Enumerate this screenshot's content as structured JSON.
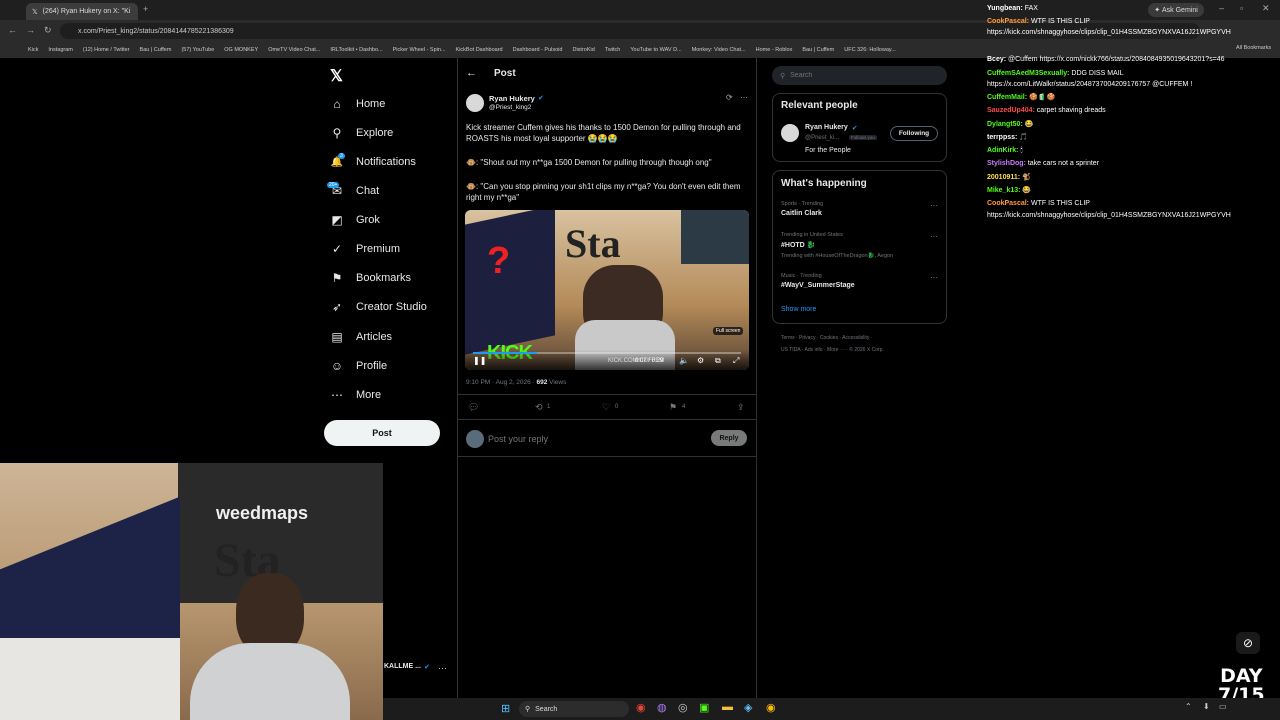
{
  "browser": {
    "tabs": [
      {
        "title": "(264) Ryan Hukery on X: \"Ki"
      }
    ],
    "url": "x.com/Priest_king2/status/2084144785221386309",
    "ask_gemini": "Ask Gemini",
    "bookmarks": [
      "Kick",
      "Instagram",
      "(12) Home / Twitter",
      "Bau | Cuffem",
      "(57) YouTube",
      "OG MONKEY",
      "OmeTV Video Chat...",
      "IRLToolkit • Dashbo...",
      "Picker Wheel - Spin...",
      "KickBot Dashboard",
      "Dashboard - Pulsoid",
      "DistroKid",
      "Twitch",
      "YouTube to WAV D...",
      "Monkey: Video Chat...",
      "Home - Roblox",
      "Bau | Cuffem",
      "UFC 326: Holloway..."
    ],
    "all_bookmarks": "All Bookmarks"
  },
  "nav": {
    "items": [
      {
        "label": "Home",
        "icon": "home-icon",
        "glyph": "⌂"
      },
      {
        "label": "Explore",
        "icon": "search-icon",
        "glyph": "⚲"
      },
      {
        "label": "Notifications",
        "icon": "bell-icon",
        "glyph": "🔔"
      },
      {
        "label": "Chat",
        "icon": "chat-icon",
        "glyph": "✉"
      },
      {
        "label": "Grok",
        "icon": "grok-icon",
        "glyph": "◩"
      },
      {
        "label": "Premium",
        "icon": "premium-icon",
        "glyph": "✓"
      },
      {
        "label": "Bookmarks",
        "icon": "bookmark-icon",
        "glyph": "⚑"
      },
      {
        "label": "Creator Studio",
        "icon": "rocket-icon",
        "glyph": "➶"
      },
      {
        "label": "Articles",
        "icon": "article-icon",
        "glyph": "▤"
      },
      {
        "label": "Profile",
        "icon": "profile-icon",
        "glyph": "☺"
      },
      {
        "label": "More",
        "icon": "more-icon",
        "glyph": "⋯"
      }
    ],
    "notif_badge": "3",
    "chat_badge": "20+",
    "post_label": "Post",
    "account_name": "KALLME ..."
  },
  "post": {
    "header": "Post",
    "author_name": "Ryan Hukery",
    "author_handle": "@Priest_king2",
    "text1": "Kick streamer Cuffem gives his thanks to 1500 Demon for pulling through and ROASTS his most loyal supporter 😭😭😭",
    "quote1": "🐵: \"Shout out my n**ga 1500 Demon for pulling through though ong\"",
    "quote2": "🐵: \"Can you stop pinning your sh1t clips my n**ga? You don't even edit them right my n**ga\"",
    "video_time": "0:07 / 0:29",
    "video_source": "KICK.COM/CUFFEM",
    "fullscreen_tooltip": "Full screen",
    "timestamp": "9:10 PM · Aug 2, 2026 · ",
    "views": "692",
    "views_label": " Views",
    "retweets": "1",
    "likes": "0",
    "bookmarks": "4",
    "reply_placeholder": "Post your reply",
    "reply_button": "Reply"
  },
  "right": {
    "search_placeholder": "Search",
    "relevant_title": "Relevant people",
    "rp_name": "Ryan Hukery",
    "rp_handle": "@Priest_ki...",
    "rp_follows": "Follows you",
    "rp_follow_btn": "Following",
    "rp_bio": "For the People",
    "happening_title": "What's happening",
    "trends": [
      {
        "meta": "Sports · Trending",
        "title": "Caitlin Clark",
        "extra": ""
      },
      {
        "meta": "Trending in United States",
        "title": "#HOTD 🐉",
        "extra": "Trending with #HouseOfTheDragon🐉, Aegon"
      },
      {
        "meta": "Music · Trending",
        "title": "#WayV_SummerStage",
        "extra": ""
      }
    ],
    "show_more": "Show more",
    "footer1": "Terms · Privacy · Cookies · Accessibility ·",
    "footer2": "US TIDA · Ads info · More ··· · © 2026 X Corp."
  },
  "chat": [
    {
      "user": "Yungbean:",
      "color": "#ffffff",
      "msg": " FAX"
    },
    {
      "user": "CookPascal:",
      "color": "#ff9d3c",
      "msg": " WTF IS THIS CLIP"
    },
    {
      "user": "",
      "color": "#ffffff",
      "msg": "https://kick.com/shnaggyhose/clips/clip_01H4SSMZBGYNXVA16J21WPGYVH"
    },
    {
      "user": "Bcey:",
      "color": "#ffffff",
      "msg": " @Cuffem https://x.com/nickk766/status/2084084935019643201?s=46"
    },
    {
      "user": "CuffemSAedM3Sexually:",
      "color": "#53fc18",
      "msg": " DDG DISS MAIL"
    },
    {
      "user": "",
      "color": "#ffffff",
      "msg": "https://x.com/LitWalkr/status/2048737004209176757 @CUFFEM !"
    },
    {
      "user": "CuffemMail:",
      "color": "#53fc18",
      "msg": " 🍪🧃🍪"
    },
    {
      "user": "SauzedUp404:",
      "color": "#ff4a4a",
      "msg": " carpet shaving dreads"
    },
    {
      "user": "Dylangt50:",
      "color": "#53fc18",
      "msg": " 😂"
    },
    {
      "user": "terrppss:",
      "color": "#ffffff",
      "msg": " 🎵"
    },
    {
      "user": "AdinKirk:",
      "color": "#53fc18",
      "msg": " 🕯"
    },
    {
      "user": "StylishDog:",
      "color": "#c77dff",
      "msg": " take cars not a sprinter"
    },
    {
      "user": "20010911:",
      "color": "#ffe14d",
      "msg": " 🐒"
    },
    {
      "user": "Mike_k13:",
      "color": "#53fc18",
      "msg": " 😂"
    },
    {
      "user": "CookPascal:",
      "color": "#ff9d3c",
      "msg": " WTF IS THIS CLIP"
    },
    {
      "user": "",
      "color": "#ffffff",
      "msg": "https://kick.com/shnaggyhose/clips/clip_01H4SSMZBGYNXVA16J21WPGYVH"
    }
  ],
  "overlay": {
    "day": "DAY",
    "day_num": "7/15"
  },
  "taskbar": {
    "search": "Search"
  },
  "colors": {
    "accent": "#1d9bf0",
    "kick": "#53fc18",
    "bg": "#000000",
    "border": "#2f3336"
  }
}
